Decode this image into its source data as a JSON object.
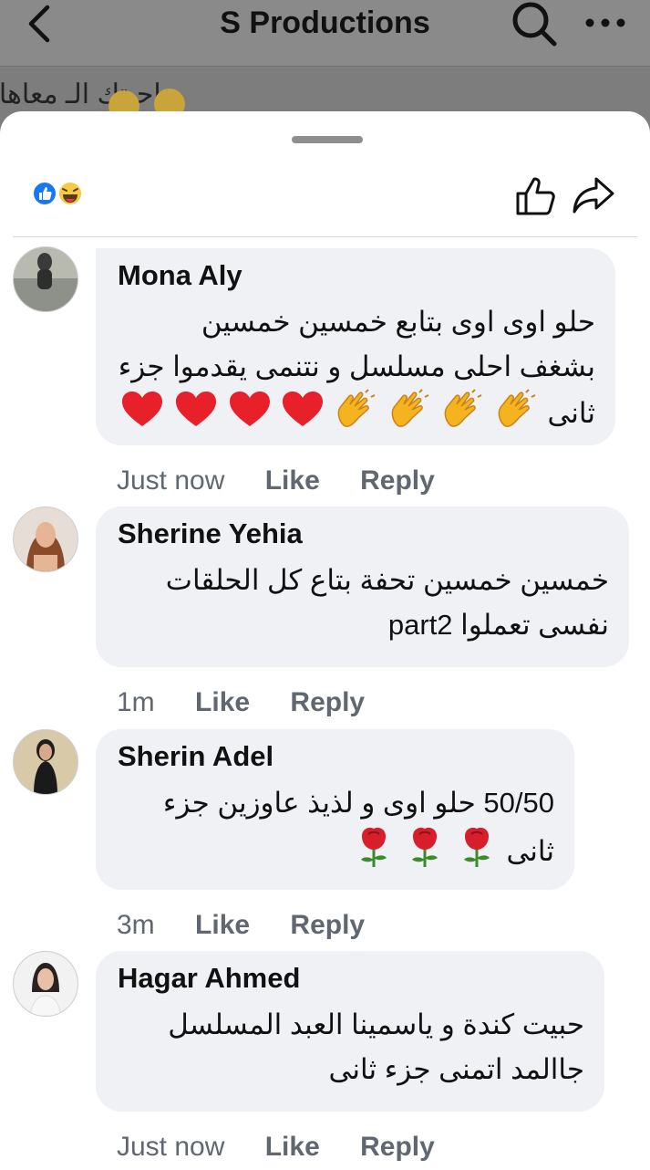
{
  "header": {
    "title": "S Productions",
    "post_preview": "صاحبتك الـ معاها كل اسرار الشله"
  },
  "comments": [
    {
      "author": "Mona Aly",
      "text": "حلو اوى اوى بتابع خمسين خمسين بشغف احلى مسلسل و نتنمى يقدموا جزء ثانى",
      "time": "Just now",
      "like": "Like",
      "reply": "Reply"
    },
    {
      "author": "Sherine Yehia",
      "text": "خمسين خمسين تحفة بتاع كل الحلقات نفسى تعملوا part2",
      "time": "1m",
      "like": "Like",
      "reply": "Reply"
    },
    {
      "author": "Sherin Adel",
      "text": "50/50 حلو اوى و لذيذ عاوزين جزء ثانى",
      "time": "3m",
      "like": "Like",
      "reply": "Reply"
    },
    {
      "author": "Hagar Ahmed",
      "text": "حبيت كندة و ياسمينا العبد المسلسل جاالمد اتمنى جزء ثانى",
      "time": "Just now",
      "like": "Like",
      "reply": "Reply"
    }
  ],
  "icons": {
    "back": "chevron-left-icon",
    "search": "search-icon",
    "more": "more-dots-icon",
    "like_reaction": "like-reaction-icon",
    "haha_reaction": "haha-reaction-icon",
    "thumb": "thumbs-up-icon",
    "share": "share-arrow-icon",
    "clap": "clapping-hands-emoji",
    "heart": "red-heart-emoji",
    "rose": "rose-emoji"
  },
  "colors": {
    "accent_blue": "#1877f2",
    "bubble": "#eff1f4",
    "meta_text": "#606770",
    "heart": "#e8202a",
    "clap": "#f5b41f"
  }
}
